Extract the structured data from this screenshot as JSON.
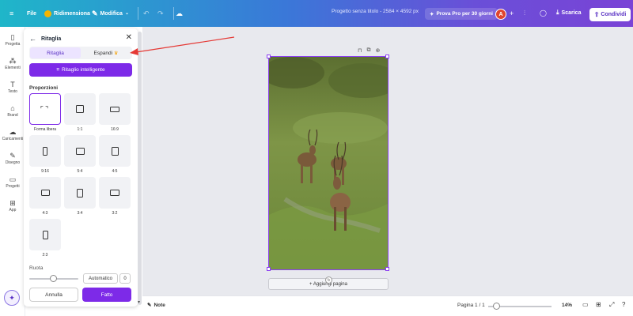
{
  "topbar": {
    "menu_icon": "hamburger-icon",
    "file_label": "File",
    "resize_label": "Ridimensiona",
    "edit_label": "Modifica",
    "doc_title": "Progetto senza titolo - 2584 × 4592 px",
    "pro_label": "Prova Pro per 30 giorni",
    "avatar_letter": "A",
    "download_label": "Scarica",
    "share_label": "Condividi"
  },
  "rail": {
    "items": [
      {
        "label": "Progetta",
        "icon": "layout-icon"
      },
      {
        "label": "Elementi",
        "icon": "shapes-icon"
      },
      {
        "label": "Testo",
        "icon": "text-icon"
      },
      {
        "label": "Brand",
        "icon": "brand-icon"
      },
      {
        "label": "Caricamenti",
        "icon": "upload-icon"
      },
      {
        "label": "Disegno",
        "icon": "draw-icon"
      },
      {
        "label": "Progetti",
        "icon": "folder-icon"
      },
      {
        "label": "App",
        "icon": "apps-icon"
      }
    ]
  },
  "panel": {
    "title": "Ritaglia",
    "tabs": [
      {
        "label": "Ritaglia",
        "active": true
      },
      {
        "label": "Espandi",
        "active": false
      }
    ],
    "smart_crop_label": "Ritaglio intelligente",
    "section_label": "Proporzioni",
    "ratios": [
      {
        "label": "Forma libera",
        "selected": true
      },
      {
        "label": "1:1"
      },
      {
        "label": "16:9"
      },
      {
        "label": "9:16"
      },
      {
        "label": "5:4"
      },
      {
        "label": "4:5"
      },
      {
        "label": "4:3"
      },
      {
        "label": "3:4"
      },
      {
        "label": "3:2"
      },
      {
        "label": "2:3"
      }
    ],
    "rotate_label": "Ruota",
    "auto_label": "Automatico",
    "rotate_value": "0",
    "cancel_label": "Annulla",
    "done_label": "Fatto"
  },
  "canvas": {
    "add_page_label": "+ Aggiungi pagina"
  },
  "bottombar": {
    "notes_label": "Note",
    "page_info": "Pagina 1 / 1",
    "zoom": "14%",
    "zoom_level": 0.14
  },
  "colors": {
    "accent": "#7d2ae8",
    "annotation_arrow": "#e53935"
  }
}
